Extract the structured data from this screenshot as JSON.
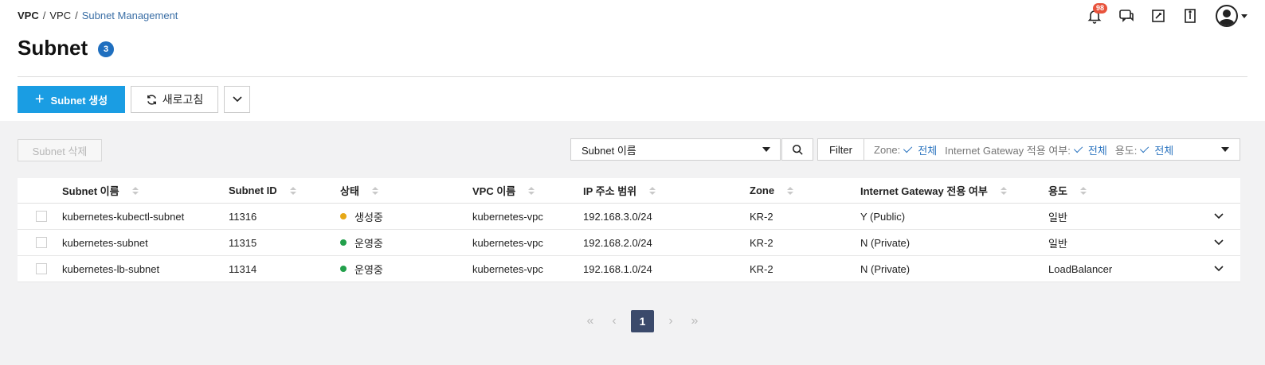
{
  "breadcrumb": {
    "items": [
      "VPC",
      "VPC",
      "Subnet Management"
    ],
    "separator": "/"
  },
  "header_icons": {
    "notification_count": "98",
    "icons": [
      "bell-icon",
      "chat-icon",
      "memo-icon",
      "book-icon",
      "user-icon"
    ]
  },
  "page": {
    "title": "Subnet",
    "count": "3"
  },
  "toolbar": {
    "create_label": "Subnet 생성",
    "refresh_label": "새로고침",
    "delete_label": "Subnet 삭제"
  },
  "search": {
    "selected_field": "Subnet 이름",
    "filter_label": "Filter",
    "filters": [
      {
        "key": "Zone:",
        "value": "전체"
      },
      {
        "key": "Internet Gateway 적용 여부:",
        "value": "전체"
      },
      {
        "key": "용도:",
        "value": "전체"
      }
    ]
  },
  "table": {
    "columns": [
      "Subnet 이름",
      "Subnet ID",
      "상태",
      "VPC 이름",
      "IP 주소 범위",
      "Zone",
      "Internet Gateway 전용 여부",
      "용도"
    ],
    "rows": [
      {
        "name": "kubernetes-kubectl-subnet",
        "id": "11316",
        "status": "생성중",
        "status_color": "#e6a817",
        "vpc": "kubernetes-vpc",
        "ip": "192.168.3.0/24",
        "zone": "KR-2",
        "igw": "Y (Public)",
        "usage": "일반"
      },
      {
        "name": "kubernetes-subnet",
        "id": "11315",
        "status": "운영중",
        "status_color": "#22a04b",
        "vpc": "kubernetes-vpc",
        "ip": "192.168.2.0/24",
        "zone": "KR-2",
        "igw": "N (Private)",
        "usage": "일반"
      },
      {
        "name": "kubernetes-lb-subnet",
        "id": "11314",
        "status": "운영중",
        "status_color": "#22a04b",
        "vpc": "kubernetes-vpc",
        "ip": "192.168.1.0/24",
        "zone": "KR-2",
        "igw": "N (Private)",
        "usage": "LoadBalancer"
      }
    ]
  },
  "pagination": {
    "current_page": "1"
  },
  "colors": {
    "primary": "#1a9de3",
    "badge": "#1f6fbf",
    "notification": "#e8533c",
    "page_active": "#3b4a6b",
    "link": "#2a73bf"
  }
}
